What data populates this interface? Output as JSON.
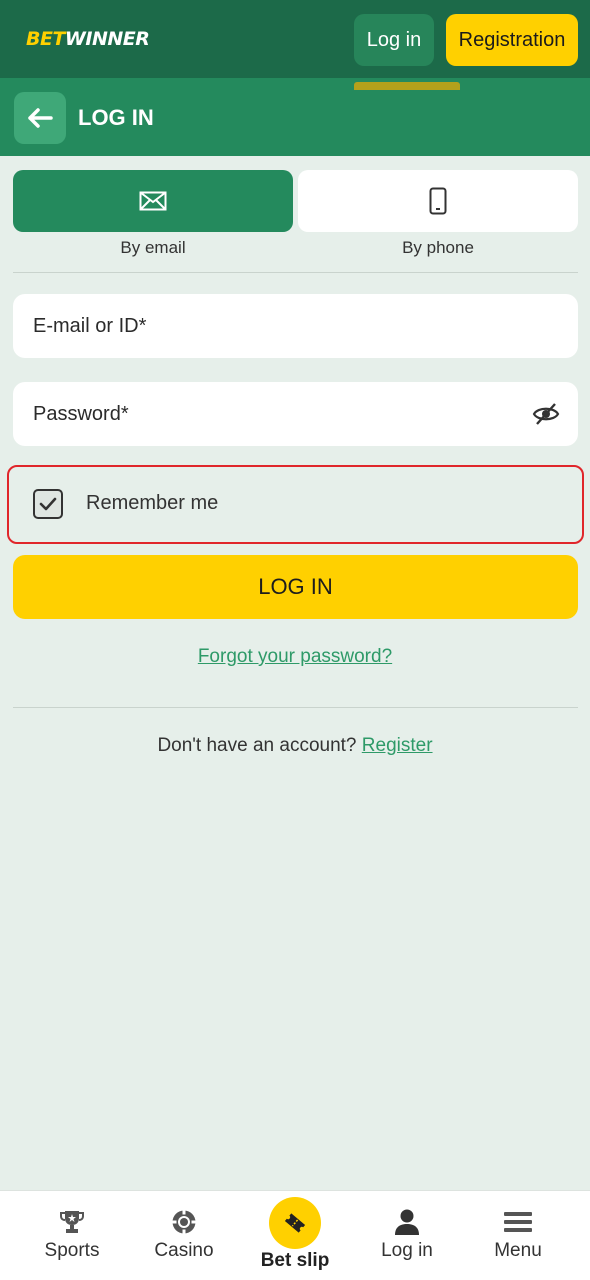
{
  "header": {
    "logo_bet": "BET",
    "logo_winner": "WINNER",
    "login_label": "Log in",
    "registration_label": "Registration"
  },
  "titlebar": {
    "title": "LOG IN",
    "back_icon": "arrow-left-icon"
  },
  "tabs": [
    {
      "label": "By email",
      "icon": "envelope-icon",
      "selected": true
    },
    {
      "label": "By phone",
      "icon": "phone-icon",
      "selected": false
    }
  ],
  "form": {
    "email_placeholder": "E-mail or ID*",
    "password_placeholder": "Password*",
    "remember_label": "Remember me",
    "remember_checked": true,
    "submit_label": "LOG IN",
    "forgot_label": "Forgot your password?",
    "no_account_text": "Don't have an account?",
    "register_link": "Register"
  },
  "bottom_nav": [
    {
      "label": "Sports",
      "icon": "trophy-icon"
    },
    {
      "label": "Casino",
      "icon": "casino-chip-icon"
    },
    {
      "label": "Bet slip",
      "icon": "ticket-icon"
    },
    {
      "label": "Log in",
      "icon": "user-icon",
      "active": true
    },
    {
      "label": "Menu",
      "icon": "hamburger-icon"
    }
  ],
  "colors": {
    "header_bg": "#1c6a49",
    "titlebar_bg": "#248a5d",
    "accent_yellow": "#ffd000",
    "link_green": "#2e9a68",
    "highlight_red": "#e0262b"
  }
}
